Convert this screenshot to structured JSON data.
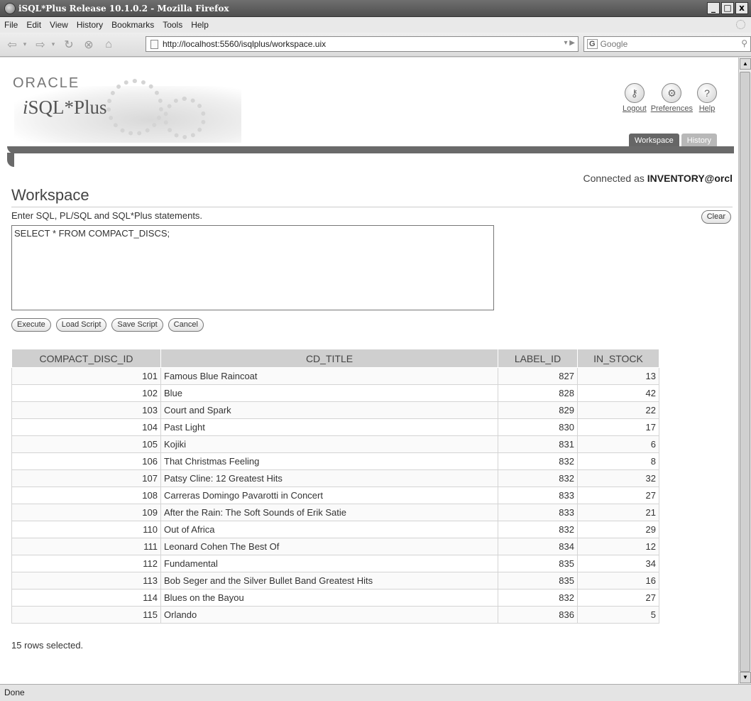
{
  "window": {
    "title": "iSQL*Plus Release 10.1.0.2 - Mozilla Firefox",
    "buttons": {
      "minimize": "_",
      "maximize": "□",
      "close": "x"
    }
  },
  "menubar": [
    "File",
    "Edit",
    "View",
    "History",
    "Bookmarks",
    "Tools",
    "Help"
  ],
  "navbar": {
    "url": "http://localhost:5560/isqlplus/workspace.uix",
    "search_placeholder": "Google",
    "search_engine_icon": "G"
  },
  "brand": {
    "oracle": "ORACLE",
    "product_prefix": "i",
    "product": "SQL*Plus"
  },
  "toplinks": [
    {
      "label": "Logout",
      "icon": "logout-icon",
      "glyph": "⚷"
    },
    {
      "label": "Preferences",
      "icon": "preferences-icon",
      "glyph": "⚙"
    },
    {
      "label": "Help",
      "icon": "help-icon",
      "glyph": "?"
    }
  ],
  "tabs": [
    {
      "label": "Workspace",
      "active": true
    },
    {
      "label": "History",
      "active": false
    }
  ],
  "connection": {
    "prefix": "Connected as",
    "user": "INVENTORY@orcl"
  },
  "workspace": {
    "title": "Workspace",
    "instructions": "Enter SQL, PL/SQL and SQL*Plus statements.",
    "clear_label": "Clear",
    "sql_text": "SELECT * FROM COMPACT_DISCS;",
    "buttons": {
      "execute": "Execute",
      "load": "Load Script",
      "save": "Save Script",
      "cancel": "Cancel"
    }
  },
  "results": {
    "columns": [
      "COMPACT_DISC_ID",
      "CD_TITLE",
      "LABEL_ID",
      "IN_STOCK"
    ],
    "rows": [
      [
        "101",
        "Famous Blue Raincoat",
        "827",
        "13"
      ],
      [
        "102",
        "Blue",
        "828",
        "42"
      ],
      [
        "103",
        "Court and Spark",
        "829",
        "22"
      ],
      [
        "104",
        "Past Light",
        "830",
        "17"
      ],
      [
        "105",
        "Kojiki",
        "831",
        "6"
      ],
      [
        "106",
        "That Christmas Feeling",
        "832",
        "8"
      ],
      [
        "107",
        "Patsy Cline: 12 Greatest Hits",
        "832",
        "32"
      ],
      [
        "108",
        "Carreras Domingo Pavarotti in Concert",
        "833",
        "27"
      ],
      [
        "109",
        "After the Rain: The Soft Sounds of Erik Satie",
        "833",
        "21"
      ],
      [
        "110",
        "Out of Africa",
        "832",
        "29"
      ],
      [
        "111",
        "Leonard Cohen The Best Of",
        "834",
        "12"
      ],
      [
        "112",
        "Fundamental",
        "835",
        "34"
      ],
      [
        "113",
        "Bob Seger and the Silver Bullet Band Greatest Hits",
        "835",
        "16"
      ],
      [
        "114",
        "Blues on the Bayou",
        "832",
        "27"
      ],
      [
        "115",
        "Orlando",
        "836",
        "5"
      ]
    ],
    "summary": "15 rows selected."
  },
  "status": "Done"
}
